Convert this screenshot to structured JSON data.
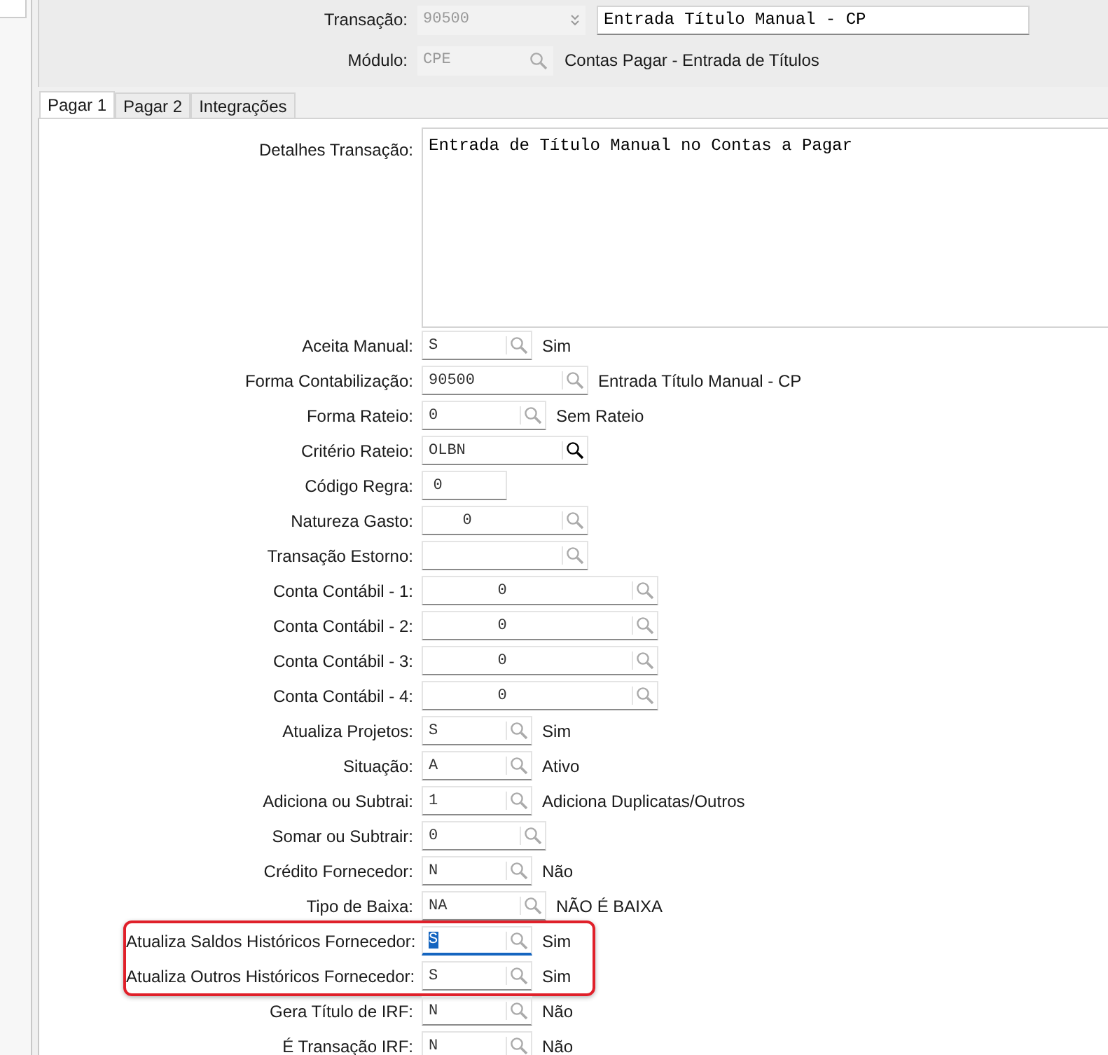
{
  "header": {
    "transacao": {
      "label": "Transação:",
      "value": "90500",
      "description": "Entrada Título Manual - CP"
    },
    "modulo": {
      "label": "Módulo:",
      "value": "CPE",
      "description": "Contas Pagar - Entrada de Títulos"
    }
  },
  "tabs": [
    {
      "label": "Pagar 1",
      "selected": true
    },
    {
      "label": "Pagar 2",
      "selected": false
    },
    {
      "label": "Integrações",
      "selected": false
    }
  ],
  "details": {
    "label": "Detalhes Transação:",
    "value": "Entrada de Título Manual no Contas a Pagar"
  },
  "fields": [
    {
      "kind": "flag",
      "label": "Aceita Manual:",
      "value": "S",
      "description": "Sim",
      "lookup_active": false,
      "focused": false
    },
    {
      "kind": "text",
      "label": "Forma Contabilização:",
      "value": "90500",
      "description": "Entrada Título Manual - CP",
      "lookup_active": false,
      "focused": false
    },
    {
      "kind": "code",
      "label": "Forma Rateio:",
      "value": "0",
      "description": "Sem Rateio",
      "lookup_active": false,
      "focused": false
    },
    {
      "kind": "text",
      "label": "Critério Rateio:",
      "value": "OLBN",
      "lookup_active": true,
      "focused": false
    },
    {
      "kind": "plain",
      "label": "Código Regra:",
      "value": "0",
      "focused": false
    },
    {
      "kind": "number",
      "label": "Natureza Gasto:",
      "value": "0",
      "lookup_active": false,
      "focused": false
    },
    {
      "kind": "number",
      "label": "Transação Estorno:",
      "lookup_active": false,
      "focused": false
    },
    {
      "kind": "account",
      "label": "Conta Contábil - 1:",
      "value": "0",
      "lookup_active": false,
      "focused": false
    },
    {
      "kind": "account",
      "label": "Conta Contábil - 2:",
      "value": "0",
      "lookup_active": false,
      "focused": false
    },
    {
      "kind": "account",
      "label": "Conta Contábil - 3:",
      "value": "0",
      "lookup_active": false,
      "focused": false
    },
    {
      "kind": "account",
      "label": "Conta Contábil - 4:",
      "value": "0",
      "lookup_active": false,
      "focused": false
    },
    {
      "kind": "flag",
      "label": "Atualiza Projetos:",
      "value": "S",
      "description": "Sim",
      "lookup_active": false,
      "focused": false
    },
    {
      "kind": "flag",
      "label": "Situação:",
      "value": "A",
      "description": "Ativo",
      "lookup_active": false,
      "focused": false
    },
    {
      "kind": "flag",
      "label": "Adiciona ou Subtrai:",
      "value": "1",
      "description": "Adiciona Duplicatas/Outros",
      "lookup_active": false,
      "focused": false
    },
    {
      "kind": "code",
      "label": "Somar ou Subtrair:",
      "value": "0",
      "lookup_active": false,
      "focused": false
    },
    {
      "kind": "flag",
      "label": "Crédito Fornecedor:",
      "value": "N",
      "description": "Não",
      "lookup_active": false,
      "focused": false
    },
    {
      "kind": "code",
      "label": "Tipo de Baixa:",
      "value": "NA",
      "description": "NÃO É BAIXA",
      "lookup_active": false,
      "focused": false
    },
    {
      "kind": "highlight",
      "fields": [
        {
          "kind": "flag",
          "label": "Atualiza Saldos Históricos Fornecedor:",
          "value": "S",
          "description": "Sim",
          "lookup_active": false,
          "focused": true
        },
        {
          "kind": "flag",
          "label": "Atualiza Outros Históricos Fornecedor:",
          "value": "S",
          "description": "Sim",
          "lookup_active": false,
          "focused": false
        }
      ]
    },
    {
      "kind": "flag",
      "label": "Gera Título de IRF:",
      "value": "N",
      "description": "Não",
      "lookup_active": false,
      "focused": false
    },
    {
      "kind": "flag",
      "label": "É Transação IRF:",
      "value": "N",
      "description": "Não",
      "lookup_active": false,
      "focused": false
    }
  ]
}
